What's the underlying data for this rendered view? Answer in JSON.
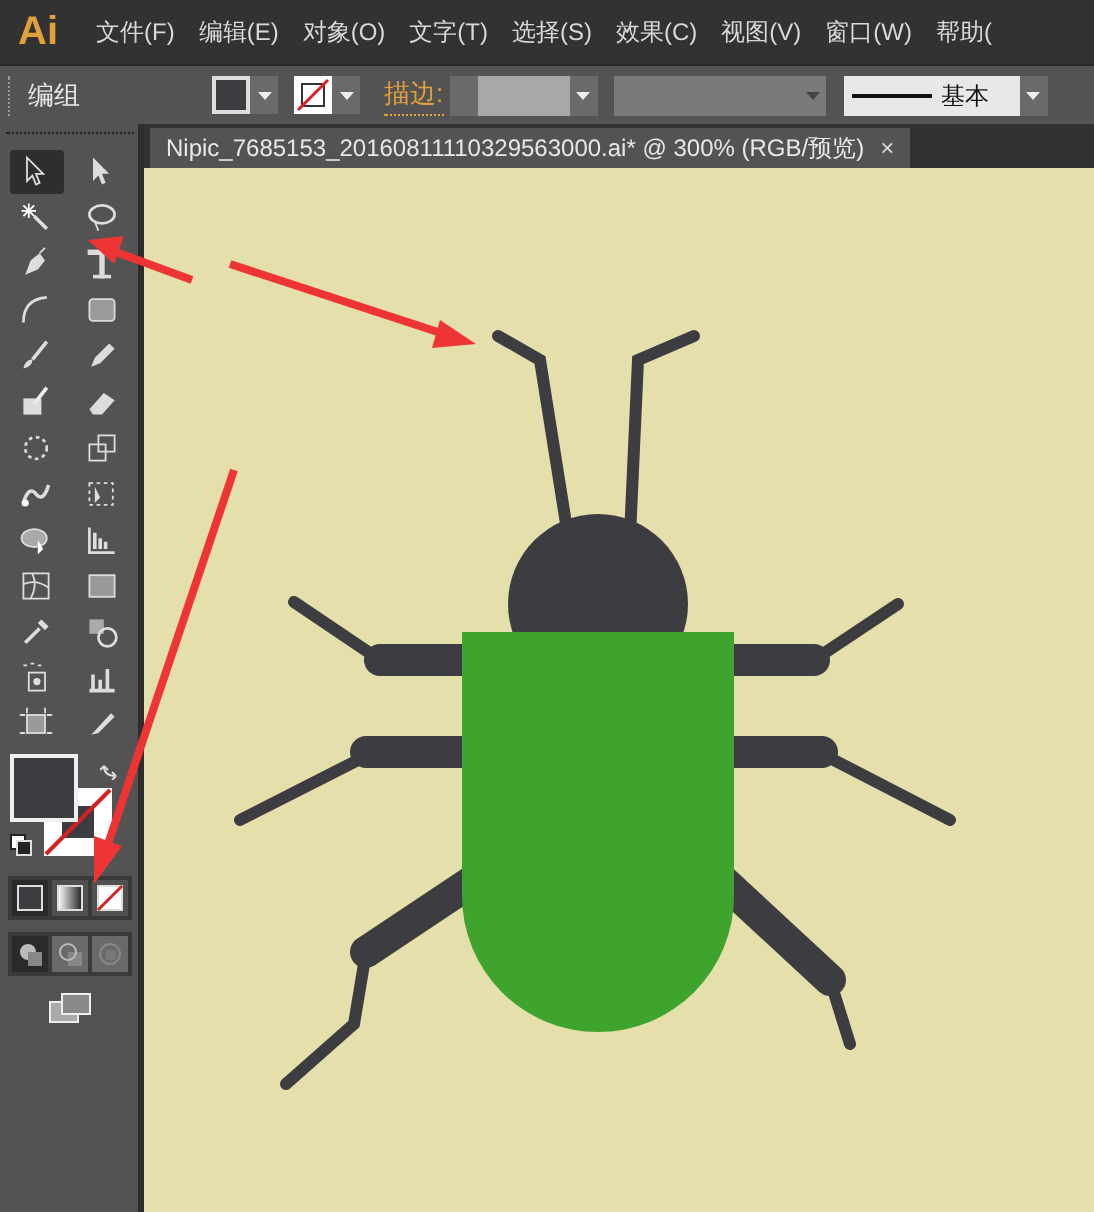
{
  "app": {
    "logo": "Ai"
  },
  "menu": [
    {
      "label": "文件(F)"
    },
    {
      "label": "编辑(E)"
    },
    {
      "label": "对象(O)"
    },
    {
      "label": "文字(T)"
    },
    {
      "label": "选择(S)"
    },
    {
      "label": "效果(C)"
    },
    {
      "label": "视图(V)"
    },
    {
      "label": "窗口(W)"
    },
    {
      "label": "帮助("
    }
  ],
  "control_bar": {
    "selection": "编组",
    "stroke_label": "描边:",
    "style": "基本"
  },
  "document_tab": {
    "title": "Nipic_7685153_20160811110329563000.ai*  @  300%  (RGB/预览)",
    "close": "×"
  },
  "tools": [
    {
      "selected": true
    },
    {
      "selected": false
    },
    {
      "selected": false
    },
    {
      "selected": false
    },
    {
      "selected": false
    },
    {
      "selected": false
    },
    {
      "selected": false
    },
    {
      "selected": false
    },
    {
      "selected": false
    },
    {
      "selected": false
    },
    {
      "selected": false
    },
    {
      "selected": false
    },
    {
      "selected": false
    },
    {
      "selected": false
    },
    {
      "selected": false
    },
    {
      "selected": false
    },
    {
      "selected": false
    },
    {
      "selected": false
    },
    {
      "selected": false
    },
    {
      "selected": false
    },
    {
      "selected": false
    },
    {
      "selected": false
    },
    {
      "selected": false
    },
    {
      "selected": false
    },
    {
      "selected": false
    },
    {
      "selected": false
    }
  ],
  "color_modes": [
    {
      "selected": true
    },
    {
      "selected": false
    },
    {
      "selected": false
    }
  ],
  "draw_modes": [
    {
      "selected": true
    },
    {
      "selected": false
    },
    {
      "selected": false
    }
  ]
}
